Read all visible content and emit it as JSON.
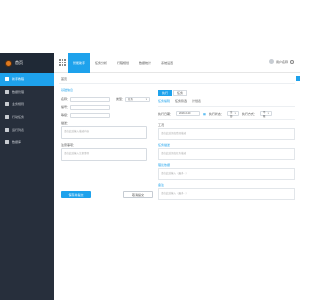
{
  "brand": {
    "name": "首页"
  },
  "nav": {
    "items": [
      {
        "label": "智能助手"
      },
      {
        "label": "任务分析"
      },
      {
        "label": "行程规划"
      },
      {
        "label": "数据统计"
      },
      {
        "label": "系统设置"
      }
    ]
  },
  "user": {
    "name": "用户名称"
  },
  "sidebar": {
    "items": [
      {
        "label": "新手教程"
      },
      {
        "label": "数据管理"
      },
      {
        "label": "业务规则"
      },
      {
        "label": "行动任务"
      },
      {
        "label": "运行列表"
      },
      {
        "label": "数据库"
      }
    ]
  },
  "page": {
    "crumb": "首页",
    "section_title": "基础信息",
    "fields": {
      "name_label": "名称：",
      "name_placeholder": "",
      "type_label": "类型：",
      "type_value": "任务",
      "code_label": "编号：",
      "code_placeholder": "",
      "level_label": "等级：",
      "level_placeholder": "",
      "desc_label": "描述：",
      "desc_placeholder": "请在此处输入描述内容",
      "note_label": "注意事项：",
      "note_placeholder": "请在此处输入注意事项"
    },
    "buttons": {
      "save": "保存并提交",
      "cancel": "取消提交"
    }
  },
  "right": {
    "tabs": [
      {
        "label": "执行"
      },
      {
        "label": "任务"
      }
    ],
    "sub_tabs": [
      {
        "label": "任务编辑"
      },
      {
        "label": "任务筛选"
      },
      {
        "label": "计划表"
      }
    ],
    "filter": {
      "date_label": "执行日期：",
      "date_value": "2018-3-20",
      "status_label": "执行状态：",
      "status_value": "全部",
      "type_label": "执行方式：",
      "type_value": "不限"
    },
    "sections": [
      {
        "label": "工况",
        "text": "请在此处添加情况描述"
      },
      {
        "label": "任务描述",
        "text": "请在此处添加任务描述"
      },
      {
        "label": "理论依据",
        "text": "请在此处输入（最多...）"
      },
      {
        "label": "备注",
        "text": "请在此处输入（最多...）"
      }
    ]
  }
}
